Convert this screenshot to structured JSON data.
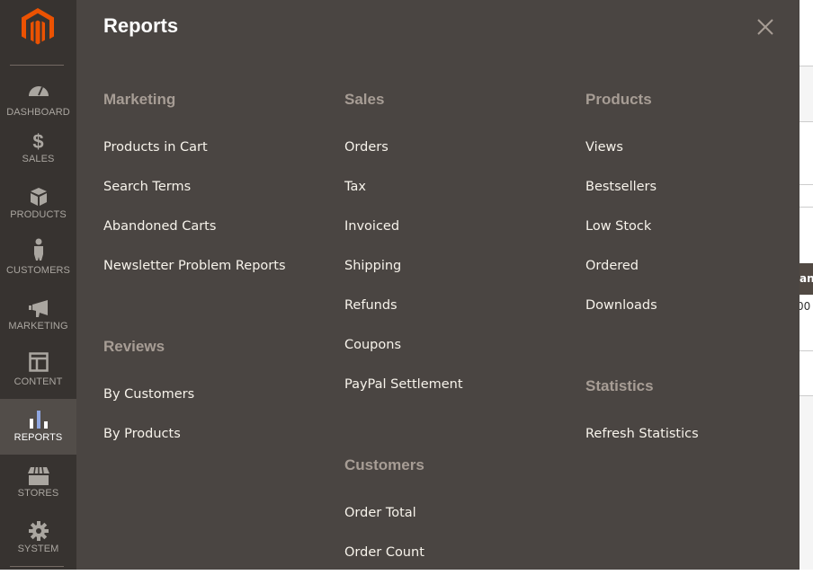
{
  "background_page": {
    "table_header_fragment": "an",
    "cell_fragment": "00"
  },
  "sidebar": {
    "items": [
      {
        "label": "DASHBOARD",
        "icon": "dashboard-gauge-icon"
      },
      {
        "label": "SALES",
        "icon": "dollar-icon"
      },
      {
        "label": "PRODUCTS",
        "icon": "box-icon"
      },
      {
        "label": "CUSTOMERS",
        "icon": "person-icon"
      },
      {
        "label": "MARKETING",
        "icon": "megaphone-icon"
      },
      {
        "label": "CONTENT",
        "icon": "layout-icon"
      },
      {
        "label": "REPORTS",
        "icon": "bar-chart-icon",
        "active": true
      },
      {
        "label": "STORES",
        "icon": "storefront-icon"
      },
      {
        "label": "SYSTEM",
        "icon": "gear-icon"
      }
    ]
  },
  "panel": {
    "title": "Reports",
    "columns": [
      {
        "sections": [
          {
            "heading": "Marketing",
            "items": [
              "Products in Cart",
              "Search Terms",
              "Abandoned Carts",
              "Newsletter Problem Reports"
            ]
          },
          {
            "heading": "Reviews",
            "items": [
              "By Customers",
              "By Products"
            ]
          }
        ]
      },
      {
        "sections": [
          {
            "heading": "Sales",
            "items": [
              "Orders",
              "Tax",
              "Invoiced",
              "Shipping",
              "Refunds",
              "Coupons",
              "PayPal Settlement"
            ]
          },
          {
            "heading": "Customers",
            "items": [
              "Order Total",
              "Order Count"
            ]
          }
        ]
      },
      {
        "sections": [
          {
            "heading": "Products",
            "items": [
              "Views",
              "Bestsellers",
              "Low Stock",
              "Ordered",
              "Downloads"
            ]
          },
          {
            "heading": "Statistics",
            "items": [
              "Refresh Statistics"
            ]
          }
        ]
      }
    ]
  },
  "colors": {
    "sidebar_bg": "#373330",
    "panel_bg": "#4a4542",
    "active_bg": "#524d49",
    "logo": "#eb5202",
    "heading": "#a79d95"
  }
}
